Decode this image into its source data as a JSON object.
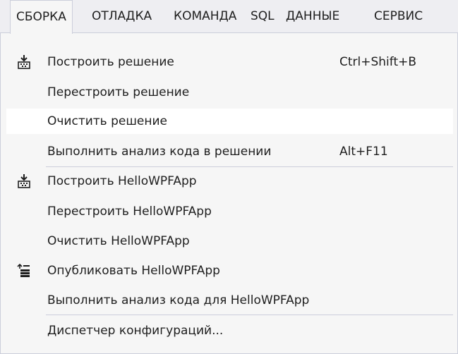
{
  "menubar": {
    "items": [
      {
        "label": "СБОРКА"
      },
      {
        "label": "ОТЛАДКА"
      },
      {
        "label": "КОМАНДА"
      },
      {
        "label": "SQL"
      },
      {
        "label": "ДАННЫЕ"
      },
      {
        "label": "СЕРВИС"
      }
    ]
  },
  "menu": {
    "items": [
      {
        "label": "Построить решение",
        "shortcut": "Ctrl+Shift+B",
        "icon": "build-icon"
      },
      {
        "label": "Перестроить решение"
      },
      {
        "label": "Очистить решение"
      },
      {
        "label": "Выполнить анализ кода в решении",
        "shortcut": "Alt+F11"
      },
      {
        "label": "Построить HelloWPFApp",
        "icon": "build-icon"
      },
      {
        "label": "Перестроить HelloWPFApp"
      },
      {
        "label": "Очистить HelloWPFApp"
      },
      {
        "label": "Опубликовать HelloWPFApp",
        "icon": "publish-icon"
      },
      {
        "label": "Выполнить анализ кода для HelloWPFApp"
      },
      {
        "label": "Диспетчер конфигураций..."
      }
    ]
  }
}
